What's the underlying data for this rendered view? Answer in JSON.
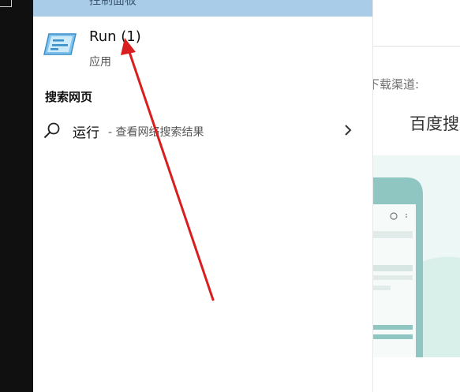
{
  "search_panel": {
    "top_result_label": "控制面板",
    "app_result": {
      "title": "Run (1)",
      "subtitle": "应用",
      "icon": "run-app-icon"
    },
    "web_section": {
      "heading": "搜索网页",
      "query": "运行",
      "hint": "- 查看网络搜索结果",
      "icon": "search-icon",
      "chevron_icon": "chevron-right-icon"
    }
  },
  "right_pane": {
    "channel_label": "下载渠道:",
    "baidu_label": "百度搜"
  },
  "colors": {
    "highlight": "#a9cde9",
    "taskbar": "#101010",
    "annotation_arrow": "#d81e1e",
    "illustration_teal": "#8fc6c2",
    "illustration_bg": "#edf7f5"
  }
}
